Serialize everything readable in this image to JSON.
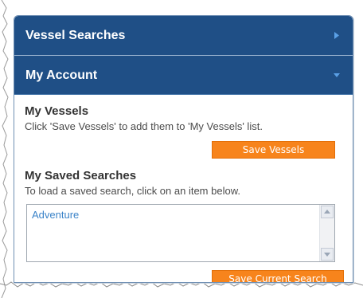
{
  "sections": {
    "vessel_searches": {
      "label": "Vessel Searches"
    },
    "my_account": {
      "label": "My Account"
    }
  },
  "my_vessels": {
    "heading": "My Vessels",
    "description": "Click 'Save Vessels' to add them to 'My Vessels' list.",
    "button_label": "Save Vessels"
  },
  "saved_searches": {
    "heading": "My Saved Searches",
    "description": "To load a saved search, click on an item below.",
    "items": [
      "Adventure"
    ],
    "button_label": "Save Current Search"
  },
  "colors": {
    "header_blue": "#1f4f86",
    "accent_orange": "#f7841c",
    "link_blue": "#3b83c8"
  },
  "icons": {
    "collapsed": "arrow-right-icon",
    "expanded": "arrow-down-icon",
    "scroll_up": "scroll-up-icon",
    "scroll_down": "scroll-down-icon"
  }
}
